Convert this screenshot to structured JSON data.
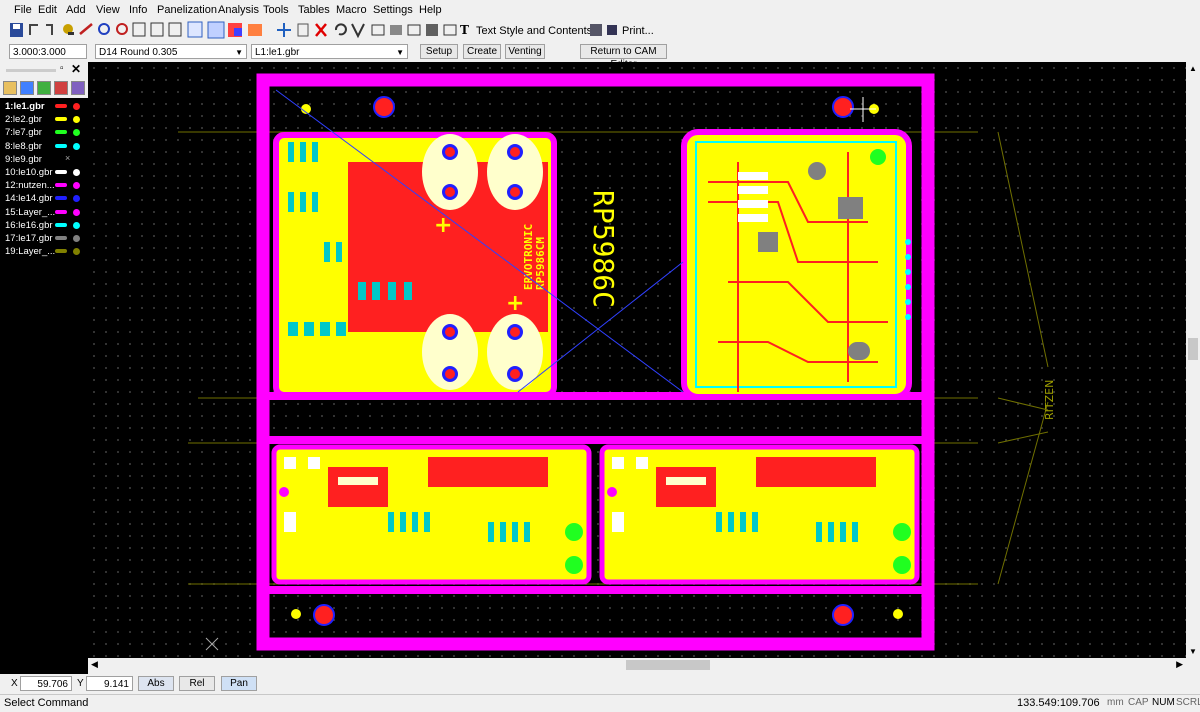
{
  "menu": [
    "File",
    "Edit",
    "Add",
    "View",
    "Info",
    "Panelization",
    "Analysis",
    "Tools",
    "Tables",
    "Macro",
    "Settings",
    "Help"
  ],
  "toolbar": {
    "text_style_label": "Text Style and Contents",
    "print_label": "Print..."
  },
  "toolbar2": {
    "zoom_value": "3.000:3.000",
    "aperture_value": "D14   Round 0.305",
    "layer_value": "L1:le1.gbr",
    "setup_label": "Setup",
    "create_label": "Create",
    "venting_label": "Venting",
    "return_label": "Return to CAM Editor"
  },
  "layers": [
    {
      "name": "1:le1.gbr",
      "color": "#ff2020",
      "active": true
    },
    {
      "name": "2:le2.gbr",
      "color": "#ffff00"
    },
    {
      "name": "7:le7.gbr",
      "color": "#20ff20"
    },
    {
      "name": "8:le8.gbr",
      "color": "#00ffff"
    },
    {
      "name": "9:le9.gbr",
      "color": "none"
    },
    {
      "name": "10:le10.gbr",
      "color": "#ffffff"
    },
    {
      "name": "12:nutzen...",
      "color": "#ff00ff"
    },
    {
      "name": "14:le14.gbr",
      "color": "#2020ff"
    },
    {
      "name": "15:Layer_...",
      "color": "#ff00ff"
    },
    {
      "name": "16:le16.gbr",
      "color": "#00ffff"
    },
    {
      "name": "17:le17.gbr",
      "color": "#808080"
    },
    {
      "name": "19:Layer_...",
      "color": "#808000"
    }
  ],
  "board": {
    "text_rp": "RP5986C",
    "text_ritzen": "RITZEN",
    "silk_ervotronic": "ERVOTRONIC",
    "silk_rp598": "RP5986CM"
  },
  "coords": {
    "x_label": "X",
    "x_value": "59.706",
    "y_label": "Y",
    "y_value": "9.141",
    "abs_label": "Abs",
    "rel_label": "Rel",
    "pan_label": "Pan"
  },
  "status": {
    "command": "Select Command",
    "position": "133.549:109.706",
    "unit": "mm",
    "cap": "CAP",
    "num": "NUM",
    "scrl": "SCRL"
  }
}
